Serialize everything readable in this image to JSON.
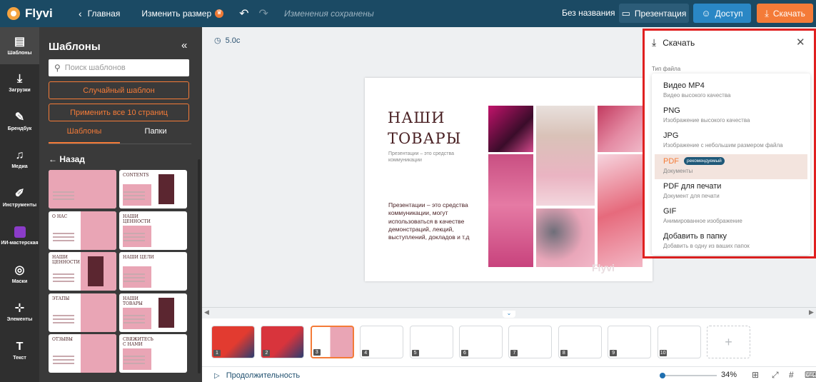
{
  "topbar": {
    "logo": "Flyvi",
    "back_label": "Главная",
    "resize_label": "Изменить размер",
    "saved_status": "Изменения сохранены",
    "doc_title": "Без названия",
    "presentation_label": "Презентация",
    "access_label": "Доступ",
    "download_label": "Скачать"
  },
  "rail": [
    {
      "label": "Шаблоны",
      "icon": "templates-icon",
      "glyph": "▤"
    },
    {
      "label": "Загрузки",
      "icon": "upload-icon",
      "glyph": "⤓"
    },
    {
      "label": "Брендбук",
      "icon": "brandbook-icon",
      "glyph": "✎"
    },
    {
      "label": "Медиа",
      "icon": "media-icon",
      "glyph": "♫"
    },
    {
      "label": "Инструменты",
      "icon": "tools-icon",
      "glyph": "✐"
    },
    {
      "label": "ИИ-мастерская",
      "icon": "ai-icon",
      "glyph": ""
    },
    {
      "label": "Маски",
      "icon": "masks-icon",
      "glyph": "◎"
    },
    {
      "label": "Элементы",
      "icon": "elements-icon",
      "glyph": "⊹"
    },
    {
      "label": "Текст",
      "icon": "text-icon",
      "glyph": "T"
    }
  ],
  "panel": {
    "title": "Шаблоны",
    "search_placeholder": "Поиск шаблонов",
    "random_label": "Случайный шаблон",
    "apply_label": "Применить все 10 страниц",
    "tab_templates": "Шаблоны",
    "tab_folders": "Папки",
    "back_label": "Назад",
    "thumbs": [
      {
        "title": ""
      },
      {
        "title": "CONTENTS"
      },
      {
        "title": "О НАС"
      },
      {
        "title": "НАШИ ЦЕННОСТИ"
      },
      {
        "title": "НАШИ ЦЕННОСТИ"
      },
      {
        "title": "НАШИ ЦЕЛИ"
      },
      {
        "title": "ЭТАПЫ"
      },
      {
        "title": "НАШИ ТОВАРЫ"
      },
      {
        "title": "ОТЗЫВЫ"
      },
      {
        "title": "СВЯЖИТЕСЬ С НАМИ"
      }
    ]
  },
  "canvas": {
    "duration": "5.0с",
    "slide": {
      "title_line1": "НАШИ",
      "title_line2": "ТОВАРЫ",
      "subtitle": "Презентации – это средства коммуникации",
      "body": "Презентации – это средства коммуникации, могут использоваться в качестве демонстраций, лекций, выступлений, докладов и т.д",
      "watermark": "Flyvi"
    },
    "pages": [
      "1",
      "2",
      "3",
      "4",
      "5",
      "6",
      "7",
      "8",
      "9",
      "10"
    ],
    "selected_page": 3,
    "duration_label": "Продолжительность",
    "zoom_value": "34%",
    "zoom_fraction": 0.03
  },
  "download": {
    "title": "Скачать",
    "file_type_label": "Тип файла",
    "options": [
      {
        "name": "Видео MP4",
        "desc": "Видео высокого качества",
        "badge": ""
      },
      {
        "name": "PNG",
        "desc": "Изображение высокого качества",
        "badge": ""
      },
      {
        "name": "JPG",
        "desc": "Изображение с небольшим размером файла",
        "badge": ""
      },
      {
        "name": "PDF",
        "desc": "Документы",
        "badge": "рекомендуемый"
      },
      {
        "name": "PDF для печати",
        "desc": "Документ для печати",
        "badge": ""
      },
      {
        "name": "GIF",
        "desc": "Анимированное изображение",
        "badge": ""
      },
      {
        "name": "Добавить в папку",
        "desc": "Добавить в одну из ваших папок",
        "badge": ""
      }
    ],
    "selected_index": 3
  },
  "colors": {
    "accent": "#f47b38",
    "topbar": "#1b4a64",
    "highlight": "#e02020"
  }
}
